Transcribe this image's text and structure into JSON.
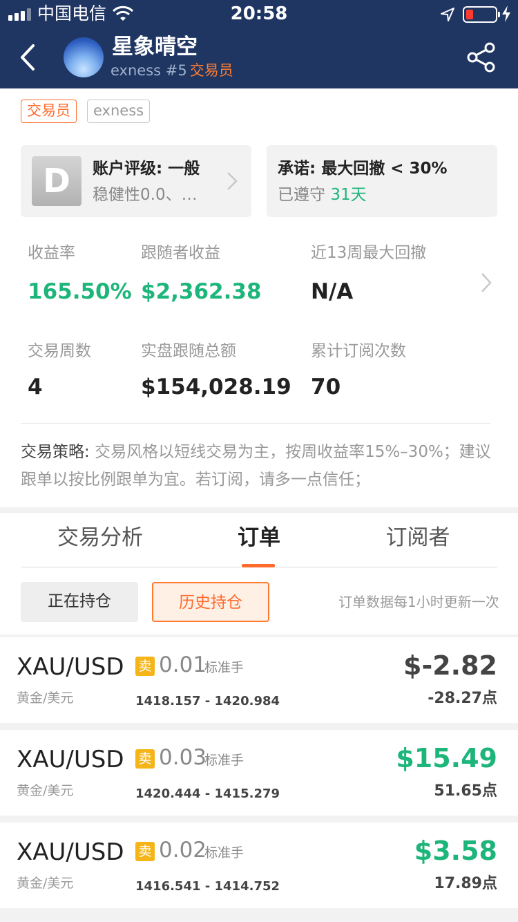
{
  "status_bar": {
    "carrier": "中国电信",
    "time": "20:58"
  },
  "header": {
    "trader_name": "星象晴空",
    "broker_rank": "exness #5",
    "role": "交易员"
  },
  "tags": {
    "trader": "交易员",
    "broker": "exness"
  },
  "rating": {
    "grade": "D",
    "title": "账户评级: 一般",
    "desc": "稳健性0.0、…"
  },
  "promise": {
    "title": "承诺: 最大回撤 < 30%",
    "status_prefix": "已遵守 ",
    "status_days": "31天"
  },
  "stats": {
    "return_label": "收益率",
    "return_value": "165.50%",
    "follower_profit_label": "跟随者收益",
    "follower_profit_value": "$2,362.38",
    "max_drawdown_label": "近13周最大回撤",
    "max_drawdown_value": "N/A",
    "weeks_label": "交易周数",
    "weeks_value": "4",
    "total_follow_label": "实盘跟随总额",
    "total_follow_value": "$154,028.19",
    "subscriptions_label": "累计订阅次数",
    "subscriptions_value": "70"
  },
  "strategy": {
    "label": "交易策略: ",
    "text": "交易风格以短线交易为主，按周收益率15%–30%；建议跟单以按比例跟单为宜。若订阅，请多一点信任；"
  },
  "tabs": {
    "analysis": "交易分析",
    "orders": "订单",
    "subscribers": "订阅者"
  },
  "order_filters": {
    "open": "正在持仓",
    "history": "历史持仓",
    "note": "订单数据每1小时更新一次"
  },
  "colors": {
    "header_bg": "#1f3663",
    "accent_orange": "#ff6b2c",
    "profit_green": "#1db57a",
    "sell_badge": "#f5b417"
  },
  "orders": [
    {
      "symbol": "XAU/USD",
      "name": "黄金/美元",
      "side": "卖",
      "lots": "0.01",
      "unit": "标准手",
      "prices": "1418.157 - 1420.984",
      "profit": "$-2.82",
      "points": "-28.27点",
      "profit_color": "#444444"
    },
    {
      "symbol": "XAU/USD",
      "name": "黄金/美元",
      "side": "卖",
      "lots": "0.03",
      "unit": "标准手",
      "prices": "1420.444 - 1415.279",
      "profit": "$15.49",
      "points": "51.65点",
      "profit_color": "#1db57a"
    },
    {
      "symbol": "XAU/USD",
      "name": "黄金/美元",
      "side": "卖",
      "lots": "0.02",
      "unit": "标准手",
      "prices": "1416.541 - 1414.752",
      "profit": "$3.58",
      "points": "17.89点",
      "profit_color": "#1db57a"
    }
  ]
}
